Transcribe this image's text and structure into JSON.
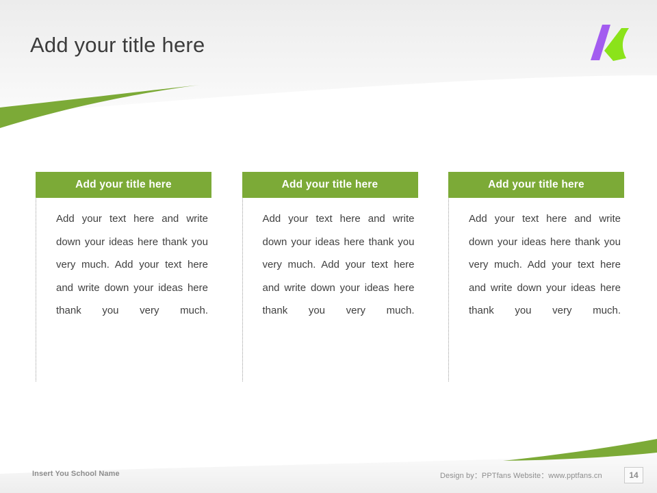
{
  "slide": {
    "title": "Add your title here",
    "logo_name": "pptfans-k-logo",
    "accent_green": "#7CAA37",
    "logo_purple": "#A35CF0",
    "logo_green": "#8BE31A",
    "header_band_color": "#F2F2F2",
    "title_color": "#3C3C3C"
  },
  "columns": [
    {
      "header": "Add your title here",
      "body": "Add your text here and write down your ideas here thank you very much. Add your text here and write down your ideas here thank you very much."
    },
    {
      "header": "Add your title here",
      "body": "Add your text here and write down your ideas here thank you very much. Add your text here and write down your ideas here thank you very much."
    },
    {
      "header": "Add your title here",
      "body": "Add your text here and write down your ideas here thank you very much. Add your text here and write down your ideas here thank you very much."
    }
  ],
  "footer": {
    "school_name": "Insert You School Name",
    "credit": "Design by：PPTfans  Website：www.pptfans.cn",
    "page_number": "14"
  }
}
